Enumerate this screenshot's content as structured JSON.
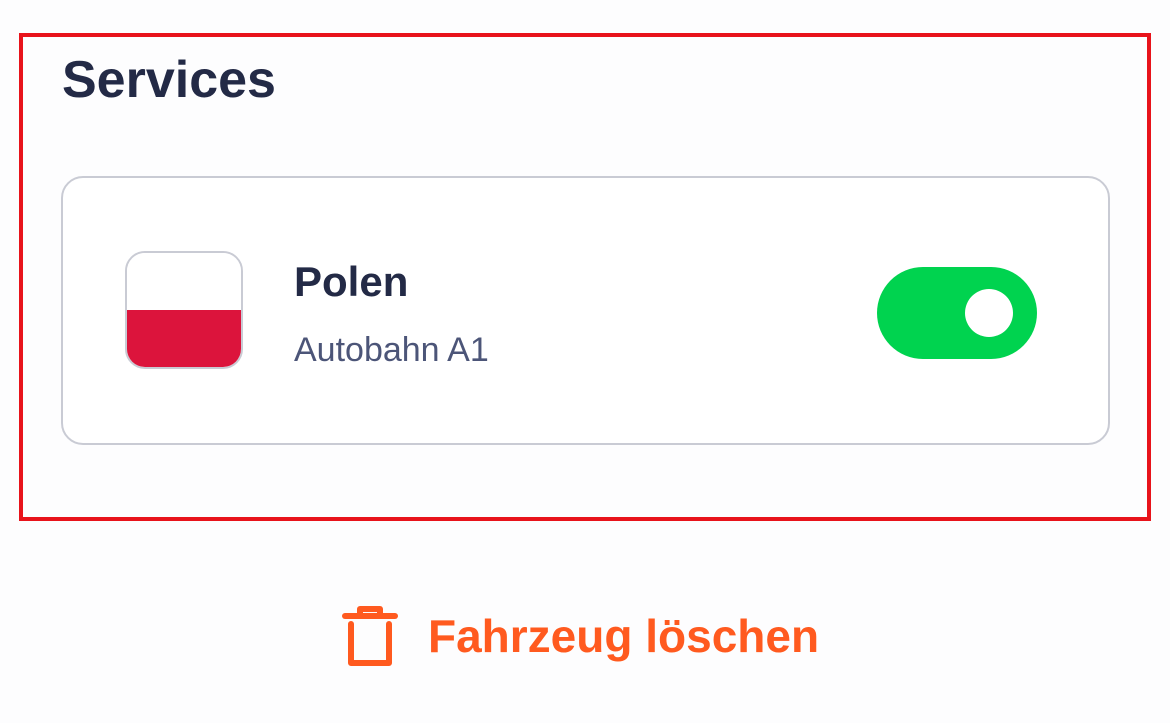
{
  "section": {
    "title": "Services"
  },
  "service": {
    "name": "Polen",
    "subtitle": "Autobahn A1",
    "flag_icon": "poland-flag-icon",
    "flag_colors": [
      "#ffffff",
      "#dc143c"
    ],
    "enabled": true
  },
  "delete_action": {
    "label": "Fahrzeug löschen",
    "icon": "trash-icon"
  },
  "colors": {
    "highlight": "#e8131b",
    "toggle_on": "#00d34f",
    "danger": "#ff5a1f",
    "title_text": "#232a46",
    "subtitle_text": "#4c5578"
  }
}
